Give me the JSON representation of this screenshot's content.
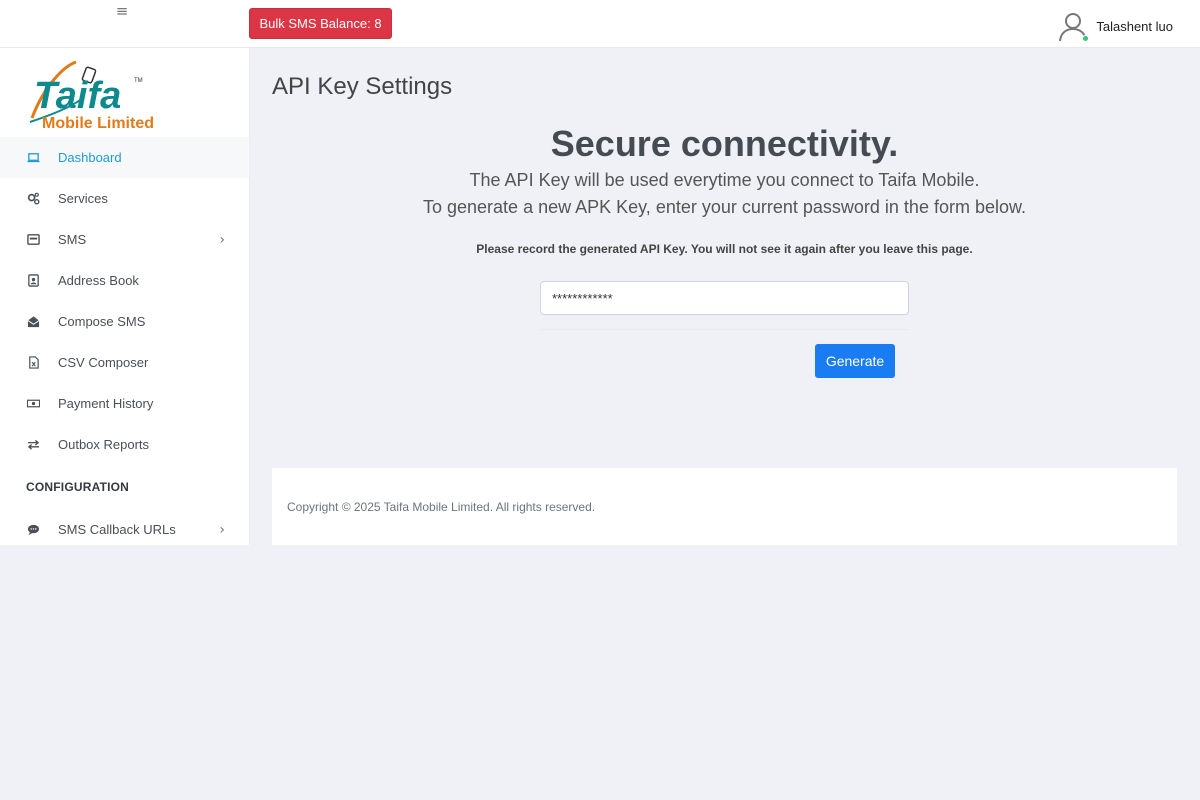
{
  "topbar": {
    "menu_icon": "hamburger-icon",
    "balance_label": "Bulk SMS Balance: 8",
    "user_name": "Talashent luo",
    "status_color": "#3ac47d"
  },
  "brand": {
    "logo_text": "Taifa",
    "logo_sub": "Mobile Limited"
  },
  "sidebar": {
    "items": [
      {
        "label": "Dashboard",
        "icon": "laptop-icon"
      },
      {
        "label": "Services",
        "icon": "gears-icon"
      },
      {
        "label": "SMS",
        "icon": "message-box-icon"
      },
      {
        "label": "Address Book",
        "icon": "address-book-icon"
      },
      {
        "label": "Compose SMS",
        "icon": "envelope-open-icon"
      },
      {
        "label": "CSV Composer",
        "icon": "csv-file-icon"
      },
      {
        "label": "Payment History",
        "icon": "money-icon"
      },
      {
        "label": "Outbox Reports",
        "icon": "exchange-icon"
      }
    ],
    "section_heading": "CONFIGURATION",
    "config_items": [
      {
        "label": "SMS Callback URLs",
        "icon": "chat-bubble-icon"
      }
    ]
  },
  "main": {
    "page_title": "API Key Settings",
    "hero_title": "Secure connectivity.",
    "hero_line1": "The API Key will be used everytime you connect to Taifa Mobile.",
    "hero_line2": "To generate a new APK Key, enter your current password in the form below.",
    "notice": "Please record the generated API Key. You will not see it again after you leave this page.",
    "key_input_value": "************",
    "generate_label": "Generate"
  },
  "footer": {
    "text": "Copyright © 2025 Taifa Mobile Limited. All rights reserved."
  },
  "colors": {
    "accent": "#1a7cf2",
    "danger": "#dc3545",
    "active_nav": "#1e9bd7",
    "brand_teal": "#0e8a8f",
    "brand_orange": "#e07b1a"
  }
}
